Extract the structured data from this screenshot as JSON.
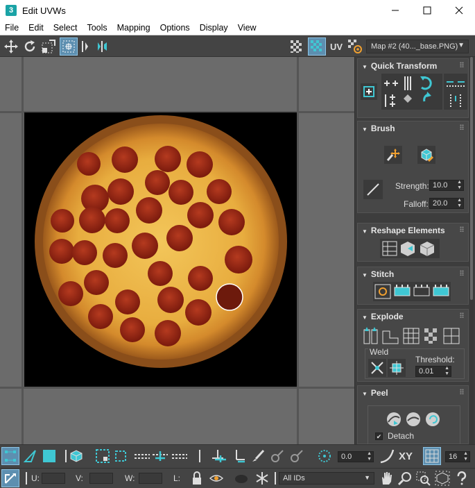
{
  "window": {
    "app_icon": "3",
    "title": "Edit UVWs",
    "minimize_icon": "minimize-icon",
    "maximize_icon": "maximize-icon",
    "close_icon": "close-icon"
  },
  "menu": [
    "File",
    "Edit",
    "Select",
    "Tools",
    "Mapping",
    "Options",
    "Display",
    "View"
  ],
  "toolbar_top": {
    "uv_label": "UV",
    "map_select": "Map #2 (40..._base.PNG)"
  },
  "colors": {
    "accent": "#3fc7d3",
    "panel_bg": "#474747",
    "viewport_bg": "#6b6b6b",
    "active_button": "#5d8fb0"
  },
  "panel": {
    "quick_transform": {
      "title": "Quick Transform"
    },
    "brush": {
      "title": "Brush",
      "strength_label": "Strength:",
      "strength_value": "10.0",
      "falloff_label": "Falloff:",
      "falloff_value": "20.0"
    },
    "reshape": {
      "title": "Reshape Elements"
    },
    "stitch": {
      "title": "Stitch"
    },
    "explode": {
      "title": "Explode",
      "weld_label": "Weld",
      "threshold_label": "Threshold:",
      "threshold_value": "0.01"
    },
    "peel": {
      "title": "Peel",
      "detach_label": "Detach",
      "detach_checked": true
    }
  },
  "bottom_bar": {
    "rotate_value": "0.0",
    "xy_label": "XY",
    "grid_value": "16",
    "u_label": "U:",
    "v_label": "V:",
    "w_label": "W:",
    "l_label": "L:",
    "ids_select": "All IDs"
  }
}
